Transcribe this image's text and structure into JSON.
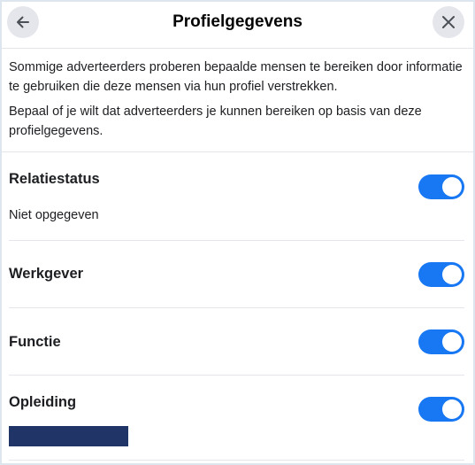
{
  "header": {
    "title": "Profielgegevens",
    "back_icon": "arrow-left-icon",
    "close_icon": "close-icon"
  },
  "intro": {
    "line1": "Sommige adverteerders proberen bepaalde mensen te bereiken door informatie te gebruiken die deze mensen via hun profiel verstrekken.",
    "line2": "Bepaal of je wilt dat adverteerders je kunnen bereiken op basis van deze profielgegevens."
  },
  "rows": [
    {
      "label": "Relatiestatus",
      "value": "Niet opgegeven",
      "toggle_on": true
    },
    {
      "label": "Werkgever",
      "toggle_on": true
    },
    {
      "label": "Functie",
      "toggle_on": true
    },
    {
      "label": "Opleiding",
      "value_redacted": true,
      "toggle_on": true
    }
  ],
  "colors": {
    "toggle_on": "#1877f2",
    "redaction": "#213467",
    "button_bg": "#e4e6eb",
    "divider": "#e4e6eb"
  }
}
